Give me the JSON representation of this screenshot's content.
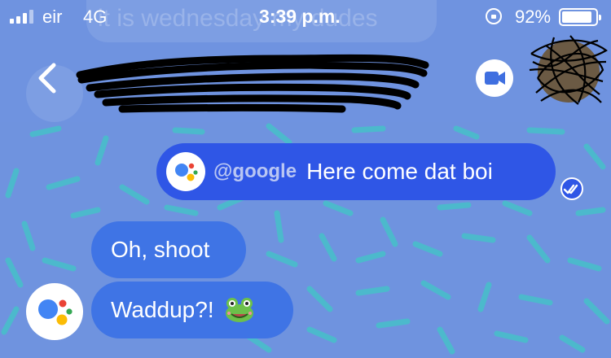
{
  "status_bar": {
    "carrier": "eir",
    "network": "4G",
    "time": "3:39 p.m.",
    "battery": "92%",
    "battery_level": 0.92
  },
  "header": {
    "background_overlay_text": "it is wednesday my dudes",
    "back_icon": "chevron-left-icon",
    "video_icon": "video-call-icon"
  },
  "messages": {
    "sent": {
      "mention": "@google",
      "text": "Here come dat boi",
      "status_icon": "double-check-icon"
    },
    "received": [
      {
        "text": "Oh, shoot"
      },
      {
        "text": "Waddup?!",
        "emoji": "frog-icon"
      }
    ]
  },
  "colors": {
    "background": "#6f93df",
    "sent_bubble": "#2f56e6",
    "received_bubble": "#3f74e5",
    "confetti": "#47c0c9",
    "assistant_blue": "#4285f4",
    "assistant_red": "#ea4335",
    "assistant_yellow": "#fbbc05",
    "assistant_green": "#34a853"
  }
}
